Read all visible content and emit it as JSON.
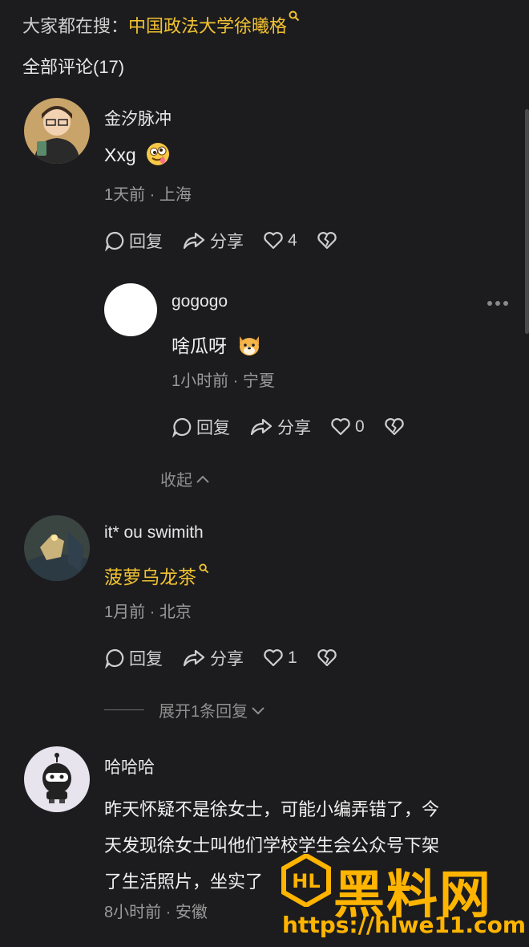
{
  "search": {
    "prefix": "大家都在搜：",
    "query": "中国政法大学徐曦格"
  },
  "comments_header": "全部评论(17)",
  "comments": [
    {
      "username": "金汐脉冲",
      "text": "Xxg",
      "emoji": "drooling-face-emoji",
      "meta": "1天前 · 上海",
      "reply_label": "回复",
      "share_label": "分享",
      "likes": "4"
    },
    {
      "username": "it* ou swimith",
      "text": "菠萝乌龙茶",
      "meta": "1月前 · 北京",
      "reply_label": "回复",
      "share_label": "分享",
      "likes": "1",
      "toggle": "展开1条回复"
    },
    {
      "username": "哈哈哈",
      "text_lines": [
        "昨天怀疑不是徐女士，可能小编弄错了，今",
        "天发现徐女士叫他们学校学生会公众号下架",
        "了生活照片，坐实了"
      ],
      "meta": "8小时前 · 安徽"
    }
  ],
  "reply": {
    "username": "gogogo",
    "text": "啥瓜呀",
    "emoji": "dog-face-emoji",
    "meta": "1小时前 · 宁夏",
    "reply_label": "回复",
    "share_label": "分享",
    "likes": "0",
    "collapse": "收起"
  },
  "watermark": {
    "brand": "黑料网",
    "url": "https://hlwe11.com"
  },
  "colors": {
    "background": "#1c1c1e",
    "accent": "#f1c232",
    "watermark": "#ffb400"
  }
}
